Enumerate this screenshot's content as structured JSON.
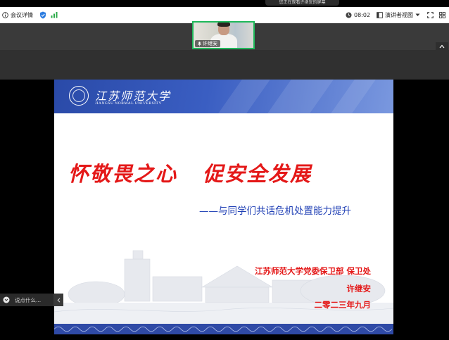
{
  "notice": {
    "text": "您正在观看许继安的屏幕"
  },
  "toolbar": {
    "meeting_info": "会议详情",
    "timer": "08:02",
    "view_mode": "演讲者视图"
  },
  "video": {
    "participant_name": "许继安"
  },
  "slide": {
    "university_cn": "江苏师范大学",
    "university_en": "JIANGSU NORMAL UNIVERSITY",
    "title_part1": "怀敬畏之心",
    "title_part2": "促安全发展",
    "subtitle": "——与同学们共话危机处置能力提升",
    "organization": "江苏师范大学党委保卫部  保卫处",
    "author": "许继安",
    "date": "二零二三年九月"
  },
  "chat": {
    "placeholder": "说点什么..."
  },
  "colors": {
    "slide_title": "#e41818",
    "subtitle": "#1f3fb5",
    "header_blue": "#2a4aa8",
    "speaker_border": "#1fb85a"
  },
  "icons": [
    "info-icon",
    "shield-icon",
    "signal-icon",
    "clock-icon",
    "layout-icon",
    "chevron-down-icon",
    "fullscreen-icon",
    "more-icon",
    "mic-icon",
    "chevron-up-icon",
    "chat-icon",
    "chevron-left-icon"
  ]
}
